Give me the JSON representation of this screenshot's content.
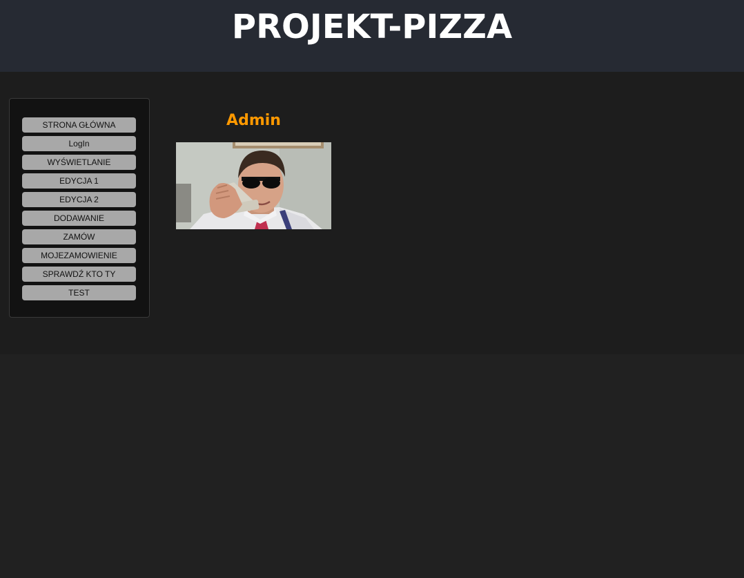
{
  "header": {
    "title": "PROJEKT-PIZZA"
  },
  "sidebar": {
    "items": [
      {
        "label": "STRONA GŁÓWNA"
      },
      {
        "label": "LogIn"
      },
      {
        "label": "WYŚWIETLANIE"
      },
      {
        "label": "EDYCJA 1"
      },
      {
        "label": "EDYCJA 2"
      },
      {
        "label": "DODAWANIE"
      },
      {
        "label": "ZAMÓW"
      },
      {
        "label": "MOJEZAMOWIENIE"
      },
      {
        "label": "SPRAWDŹ KTO TY"
      },
      {
        "label": "TEST"
      }
    ]
  },
  "main": {
    "role_title": "Admin"
  },
  "colors": {
    "header_bg": "#262a33",
    "page_bg": "#212121",
    "content_bg": "#1d1d1d",
    "sidebar_bg": "#121212",
    "nav_item_bg": "#a8a8a8",
    "accent": "#ff9900"
  }
}
